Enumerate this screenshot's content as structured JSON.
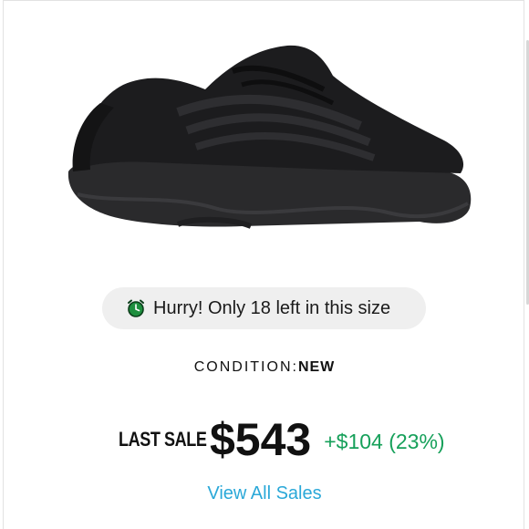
{
  "product": {
    "image_alt": "black sneaker"
  },
  "stock": {
    "icon": "alarm-clock-icon",
    "message": "Hurry! Only 18 left in this size"
  },
  "condition": {
    "label": "CONDITION:",
    "value": "NEW"
  },
  "last_sale": {
    "label": "LAST SALE",
    "price": "$543",
    "change": "+$104 (23%)"
  },
  "view_all_sales": "View All Sales",
  "colors": {
    "accent_green": "#16a05a",
    "link_blue": "#2aa8d8",
    "pill_bg": "#efefef"
  }
}
